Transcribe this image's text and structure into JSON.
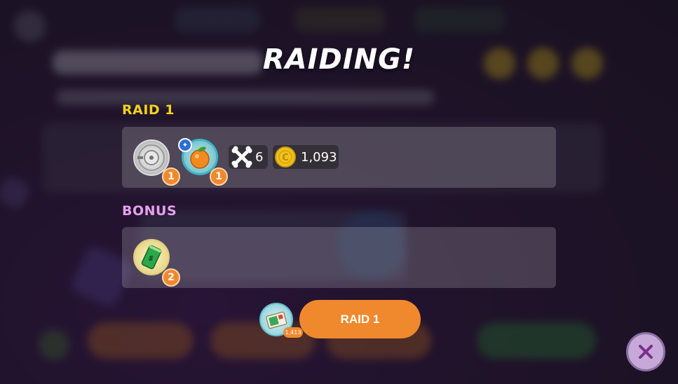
{
  "modal": {
    "title": "RAIDING!",
    "raid_section": {
      "label": "RAID 1",
      "label_color": "#f2d21a",
      "rewards": [
        {
          "name": "silver-disc-item",
          "quantity": "1"
        },
        {
          "name": "orange-fruit-item",
          "quantity": "1"
        }
      ],
      "bone_count": "6",
      "gold_amount": "1,093"
    },
    "bonus_section": {
      "label": "BONUS",
      "label_color": "#e7a0ee",
      "rewards": [
        {
          "name": "green-can-item",
          "quantity": "2"
        }
      ]
    },
    "raid_ticket_count": "1,413",
    "raid_button_label": "RAID 1",
    "close_icon": "close-icon"
  },
  "colors": {
    "accent_orange": "#f0892e",
    "panel": "rgba(255,255,255,0.18)",
    "close_button": "#c6a9d8"
  }
}
